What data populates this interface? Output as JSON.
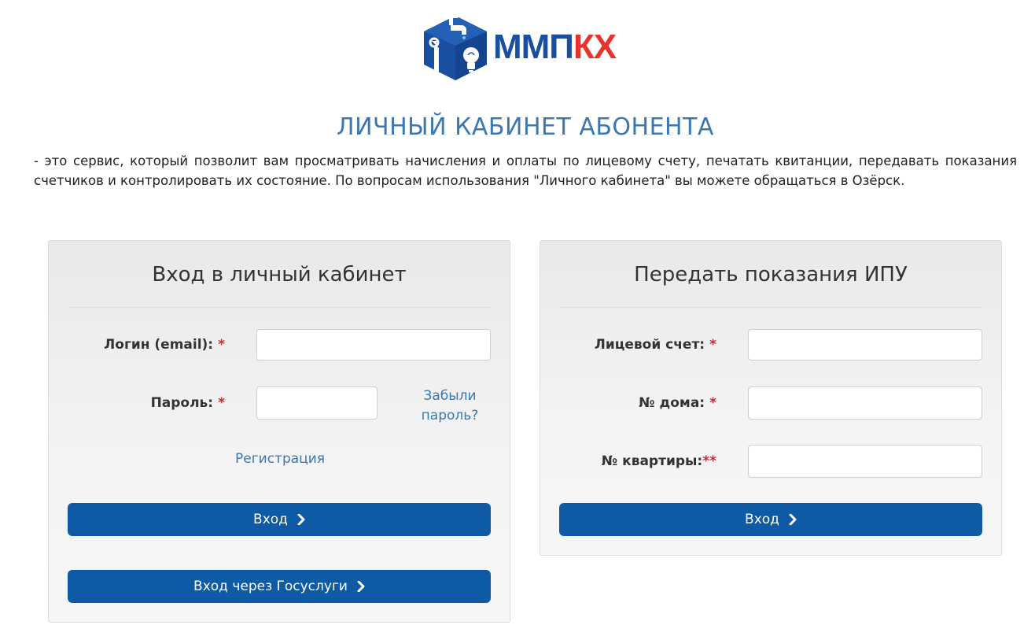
{
  "logo": {
    "text_main": "ММП",
    "text_accent": "КХ"
  },
  "page": {
    "title": "ЛИЧНЫЙ КАБИНЕТ АБОНЕНТА",
    "intro": "- это сервис, который позволит вам просматривать начисления и оплаты по лицевому счету, печатать квитанции, передавать показания счетчиков и контролировать их состояние. По вопросам использования \"Личного кабинета\" вы можете обращаться в Озёрск."
  },
  "login_panel": {
    "title": "Вход в личный кабинет",
    "login_label": "Логин (email):",
    "login_req": "*",
    "login_value": "",
    "password_label": "Пароль:",
    "password_req": "*",
    "password_value": "",
    "forgot_line1": "Забыли",
    "forgot_line2": "пароль?",
    "register_link": "Регистрация",
    "login_button": "Вход",
    "gosuslugi_button": "Вход через Госуслуги"
  },
  "meter_panel": {
    "title": "Передать показания ИПУ",
    "account_label": "Лицевой счет:",
    "account_req": "*",
    "house_label": "№ дома:",
    "house_req": "*",
    "flat_label": "№ квартиры:",
    "flat_req": "**",
    "submit_button": "Вход"
  },
  "colors": {
    "brand_blue": "#1a4fa0",
    "brand_red": "#e8322b",
    "button_blue": "#0f5aa5",
    "link_blue": "#3b78b3",
    "required_red": "#d9232a"
  }
}
